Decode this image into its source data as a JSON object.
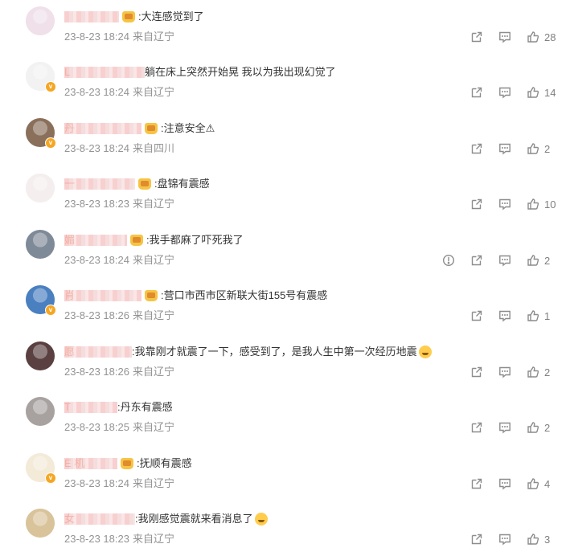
{
  "comments": [
    {
      "nick_visible": "",
      "has_crown": true,
      "text": ":大连感觉到了",
      "date": "23-8-23 18:24",
      "location": "来自辽宁",
      "likes": "28",
      "verified": false,
      "has_report": false,
      "avatar_color": "#efe0ea",
      "has_emoji": false
    },
    {
      "nick_visible": "L",
      "has_crown": false,
      "text": "躺在床上突然开始晃 我以为我出现幻觉了",
      "date": "23-8-23 18:24",
      "location": "来自辽宁",
      "likes": "14",
      "verified": true,
      "has_report": false,
      "avatar_color": "#f2f2f2",
      "has_emoji": false
    },
    {
      "nick_visible": "丹",
      "has_crown": true,
      "text": ":注意安全⚠",
      "date": "23-8-23 18:24",
      "location": "来自四川",
      "likes": "2",
      "verified": true,
      "has_report": false,
      "avatar_color": "#8a6f5a",
      "has_emoji": false
    },
    {
      "nick_visible": "一",
      "has_crown": true,
      "text": ":盘锦有震感",
      "date": "23-8-23 18:23",
      "location": "来自辽宁",
      "likes": "10",
      "verified": false,
      "has_report": false,
      "avatar_color": "#f4eeee",
      "has_emoji": false
    },
    {
      "nick_visible": "媚",
      "has_crown": true,
      "text": ":我手都麻了吓死我了",
      "date": "23-8-23 18:24",
      "location": "来自辽宁",
      "likes": "2",
      "verified": false,
      "has_report": true,
      "avatar_color": "#7f8a98",
      "has_emoji": false
    },
    {
      "nick_visible": "肖",
      "has_crown": true,
      "text": ":营口市西市区新联大街155号有震感",
      "date": "23-8-23 18:26",
      "location": "来自辽宁",
      "likes": "1",
      "verified": true,
      "has_report": false,
      "avatar_color": "#4a7fc0",
      "has_emoji": false
    },
    {
      "nick_visible": "愿",
      "has_crown": false,
      "text": ":我靠刚才就震了一下，感受到了，是我人生中第一次经历地震",
      "date": "23-8-23 18:26",
      "location": "来自辽宁",
      "likes": "2",
      "verified": false,
      "has_report": false,
      "avatar_color": "#5a4040",
      "has_emoji": true
    },
    {
      "nick_visible": "T",
      "has_crown": false,
      "text": ":丹东有震感",
      "date": "23-8-23 18:25",
      "location": "来自辽宁",
      "likes": "2",
      "verified": false,
      "has_report": false,
      "avatar_color": "#a7a2a0",
      "has_emoji": false
    },
    {
      "nick_visible": "E 机",
      "has_crown": true,
      "text": ":抚顺有震感",
      "date": "23-8-23 18:24",
      "location": "来自辽宁",
      "likes": "4",
      "verified": true,
      "has_report": false,
      "avatar_color": "#f3ead8",
      "has_emoji": false
    },
    {
      "nick_visible": "女",
      "has_crown": false,
      "text": ":我刚感觉震就来看消息了",
      "date": "23-8-23 18:23",
      "location": "来自辽宁",
      "likes": "3",
      "verified": false,
      "has_report": false,
      "avatar_color": "#d9c39a",
      "has_emoji": true
    }
  ],
  "icons": {
    "share": "share-icon",
    "comment": "comment-icon",
    "like": "thumbs-up-icon",
    "report": "report-icon"
  },
  "colors": {
    "nick": "#eb7350",
    "meta": "#939393",
    "icon": "#8c8c8c",
    "verified": "#f5a623"
  }
}
